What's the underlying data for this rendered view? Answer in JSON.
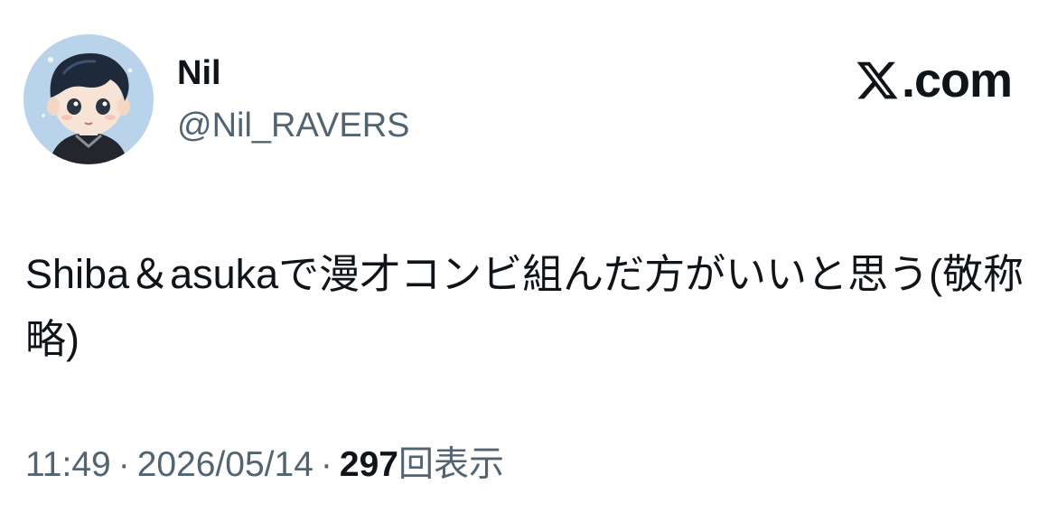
{
  "user": {
    "display_name": "Nil",
    "handle": "@Nil_RAVERS",
    "avatar_icon": "avatar-illustration"
  },
  "brand": {
    "icon": "x-logo-icon",
    "suffix": ".com"
  },
  "tweet": {
    "text": "Shiba＆asukaで漫才コンビ組んだ方がいいと思う(敬称略)"
  },
  "meta": {
    "time": "11:49",
    "separator": "·",
    "date": "2026/05/14",
    "views_count": "297",
    "views_label": "回表示"
  },
  "colors": {
    "text_primary": "#0f1419",
    "text_secondary": "#536471",
    "background": "#ffffff",
    "avatar_bg": "#b9d3ea"
  }
}
